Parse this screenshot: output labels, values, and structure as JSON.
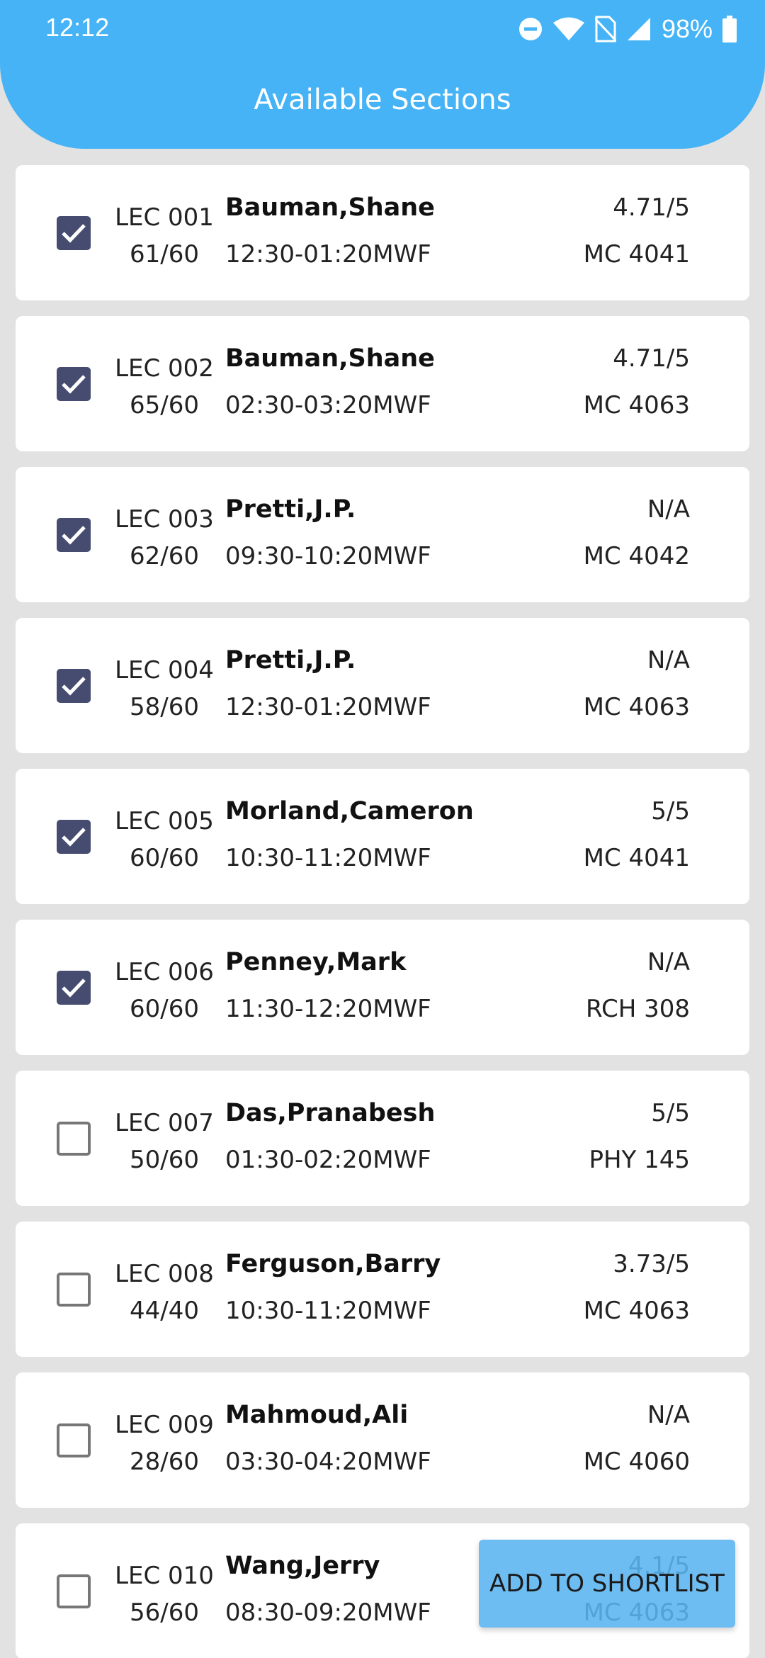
{
  "status_bar": {
    "time": "12:12",
    "battery": "98%",
    "icons": [
      "do-not-disturb-icon",
      "wifi-icon",
      "no-sim-icon",
      "signal-icon",
      "battery-icon"
    ]
  },
  "header": {
    "title": "Available Sections"
  },
  "colors": {
    "header_bg": "#45b3f5",
    "checkbox_checked": "#454c70",
    "fab_bg": "#5ab4f0"
  },
  "sections": [
    {
      "section": "LEC 001",
      "enrollment": "61/60",
      "instructor": "Bauman,Shane",
      "time": "12:30-01:20MWF",
      "rating": "4.71/5",
      "room": "MC 4041",
      "checked": true
    },
    {
      "section": "LEC 002",
      "enrollment": "65/60",
      "instructor": "Bauman,Shane",
      "time": "02:30-03:20MWF",
      "rating": "4.71/5",
      "room": "MC 4063",
      "checked": true
    },
    {
      "section": "LEC 003",
      "enrollment": "62/60",
      "instructor": "Pretti,J.P.",
      "time": "09:30-10:20MWF",
      "rating": "N/A",
      "room": "MC 4042",
      "checked": true
    },
    {
      "section": "LEC 004",
      "enrollment": "58/60",
      "instructor": "Pretti,J.P.",
      "time": "12:30-01:20MWF",
      "rating": "N/A",
      "room": "MC 4063",
      "checked": true
    },
    {
      "section": "LEC 005",
      "enrollment": "60/60",
      "instructor": "Morland,Cameron",
      "time": "10:30-11:20MWF",
      "rating": "5/5",
      "room": "MC 4041",
      "checked": true
    },
    {
      "section": "LEC 006",
      "enrollment": "60/60",
      "instructor": "Penney,Mark",
      "time": "11:30-12:20MWF",
      "rating": "N/A",
      "room": "RCH 308",
      "checked": true
    },
    {
      "section": "LEC 007",
      "enrollment": "50/60",
      "instructor": "Das,Pranabesh",
      "time": "01:30-02:20MWF",
      "rating": "5/5",
      "room": "PHY 145",
      "checked": false
    },
    {
      "section": "LEC 008",
      "enrollment": "44/40",
      "instructor": "Ferguson,Barry",
      "time": "10:30-11:20MWF",
      "rating": "3.73/5",
      "room": "MC 4063",
      "checked": false
    },
    {
      "section": "LEC 009",
      "enrollment": "28/60",
      "instructor": "Mahmoud,Ali",
      "time": "03:30-04:20MWF",
      "rating": "N/A",
      "room": "MC 4060",
      "checked": false
    },
    {
      "section": "LEC 010",
      "enrollment": "56/60",
      "instructor": "Wang,Jerry",
      "time": "08:30-09:20MWF",
      "rating": "4.1/5",
      "room": "MC 4063",
      "checked": false
    }
  ],
  "actions": {
    "add_to_shortlist": "ADD TO SHORTLIST"
  }
}
